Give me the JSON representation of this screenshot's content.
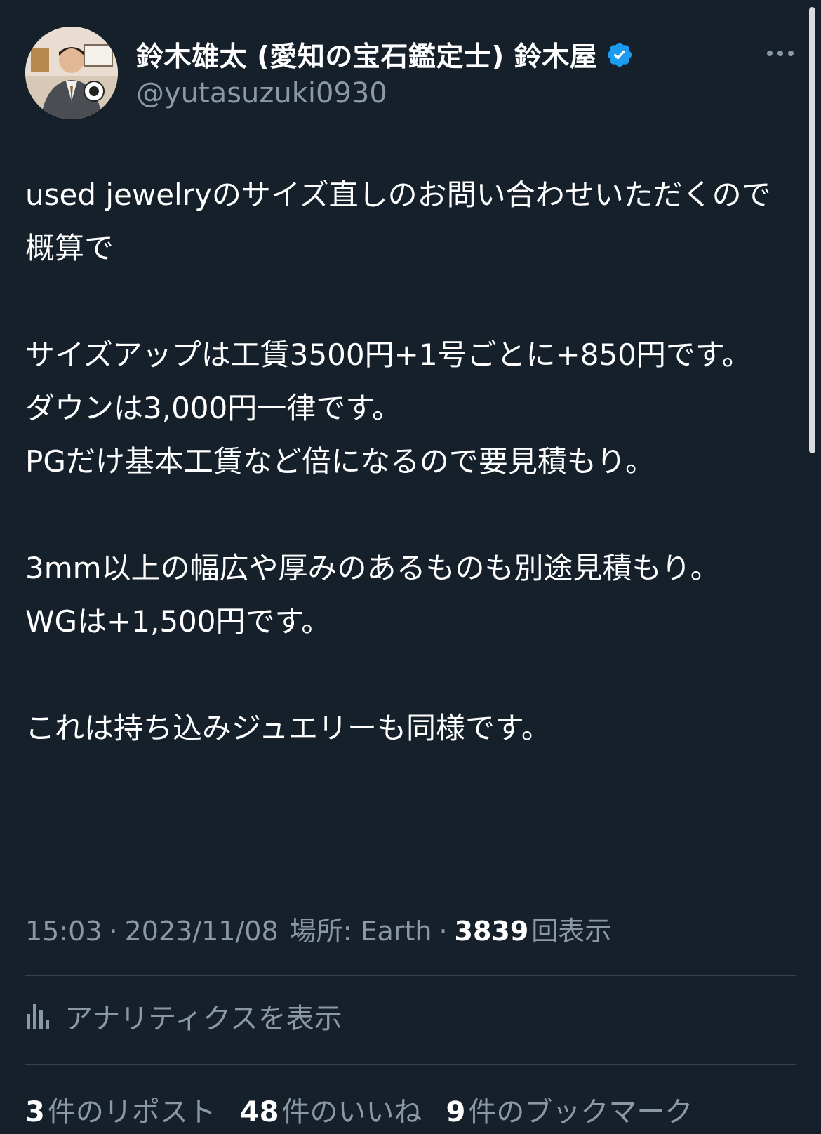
{
  "user": {
    "display_name": "鈴木雄太 (愛知の宝石鑑定士) 鈴木屋",
    "handle": "@yutasuzuki0930",
    "verified_icon": "verified-badge-icon",
    "more_icon": "more-horizontal-icon"
  },
  "tweet": {
    "text": "used jewelryのサイズ直しのお問い合わせいただくので概算で\n\nサイズアップは工賃3500円+1号ごとに+850円です。\nダウンは3,000円一律です。\nPGだけ基本工賃など倍になるので要見積もり。\n\n3mm以上の幅広や厚みのあるものも別途見積もり。\nWGは+1,500円です。\n\nこれは持ち込みジュエリーも同様です。"
  },
  "meta": {
    "time": "15:03",
    "sep1": "·",
    "date": "2023/11/08",
    "location": "場所: Earth",
    "sep2": "·",
    "views_count": "3839",
    "views_label": "回表示"
  },
  "analytics": {
    "label": "アナリティクスを表示",
    "icon": "analytics-bar-icon"
  },
  "stats": {
    "reposts_count": "3",
    "reposts_label": "件のリポスト",
    "likes_count": "48",
    "likes_label": "件のいいね",
    "bookmarks_count": "9",
    "bookmarks_label": "件のブックマーク"
  },
  "colors": {
    "background": "#15202b",
    "text": "#ffffff",
    "secondary": "#8b98a5",
    "verified": "#1d9bf0",
    "divider": "#38444d"
  }
}
